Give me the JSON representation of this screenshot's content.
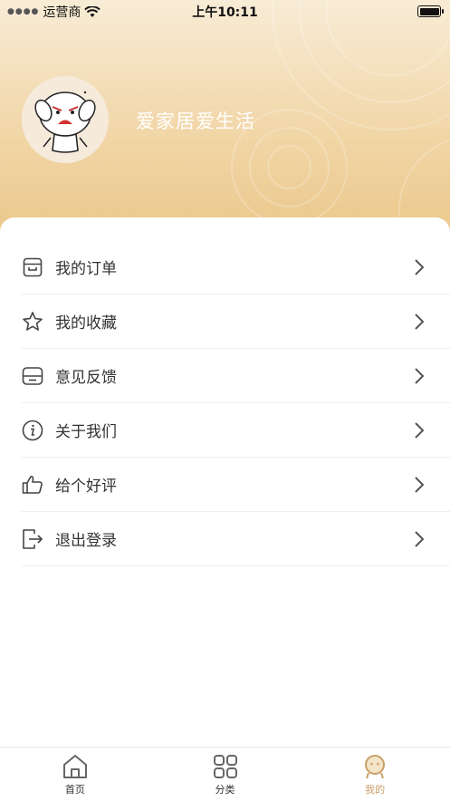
{
  "status_bar": {
    "carrier": "运营商",
    "time": "上午10:11"
  },
  "profile": {
    "username": "爱家居爱生活"
  },
  "menu": [
    {
      "label": "我的订单",
      "icon": "order-box-icon"
    },
    {
      "label": "我的收藏",
      "icon": "star-icon"
    },
    {
      "label": "意见反馈",
      "icon": "feedback-tray-icon"
    },
    {
      "label": "关于我们",
      "icon": "info-icon"
    },
    {
      "label": "给个好评",
      "icon": "thumbs-up-icon"
    },
    {
      "label": "退出登录",
      "icon": "logout-icon"
    }
  ],
  "tabbar": [
    {
      "label": "首页",
      "icon": "home-icon",
      "active": false
    },
    {
      "label": "分类",
      "icon": "grid-icon",
      "active": false
    },
    {
      "label": "我的",
      "icon": "profile-face-icon",
      "active": true
    }
  ],
  "colors": {
    "accent": "#c9a06a",
    "header_top": "#f8ecd6",
    "header_bottom": "#ebc789"
  }
}
